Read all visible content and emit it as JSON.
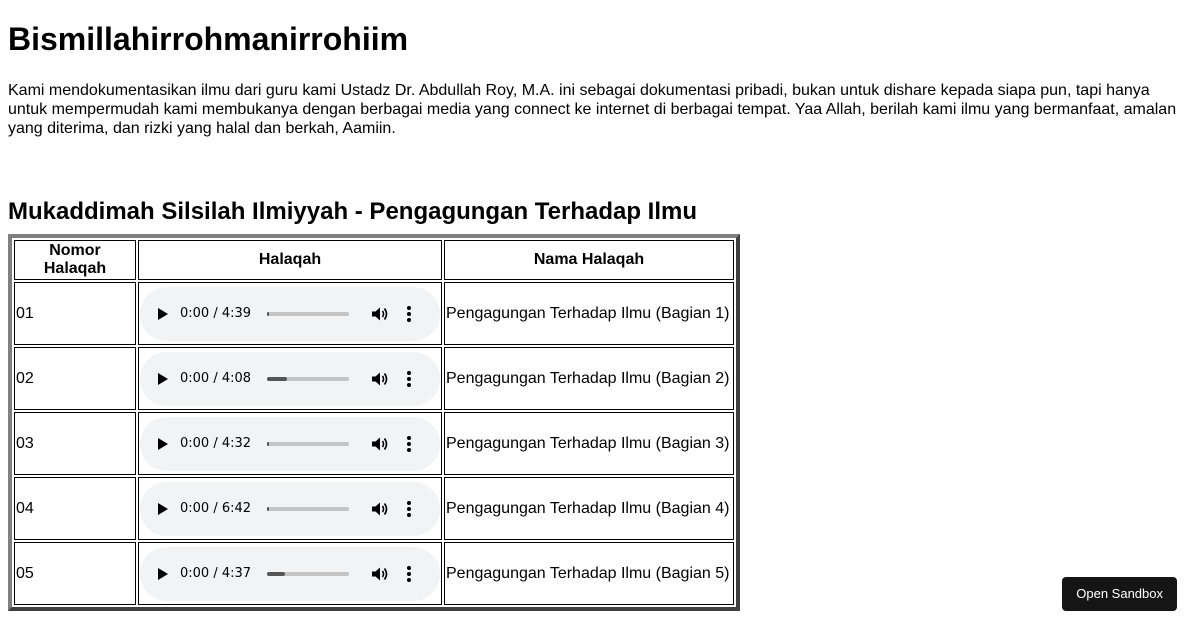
{
  "heading": "Bismillahirrohmanirrohiim",
  "intro": "Kami mendokumentasikan ilmu dari guru kami Ustadz Dr. Abdullah Roy, M.A. ini sebagai dokumentasi pribadi, bukan untuk dishare kepada siapa pun, tapi hanya untuk mempermudah kami membukanya dengan berbagai media yang connect ke internet di berbagai tempat. Yaa Allah, berilah kami ilmu yang bermanfaat, amalan yang diterima, dan rizki yang halal dan berkah, Aamiin.",
  "section_title": "Mukaddimah Silsilah Ilmiyyah - Pengagungan Terhadap Ilmu",
  "table": {
    "headers": [
      "Nomor Halaqah",
      "Halaqah",
      "Nama Halaqah"
    ],
    "rows": [
      {
        "nomor": "01",
        "time": "0:00 / 4:39",
        "buffered": 0.02,
        "nama": "Pengagungan Terhadap Ilmu (Bagian 1)"
      },
      {
        "nomor": "02",
        "time": "0:00 / 4:08",
        "buffered": 0.24,
        "nama": "Pengagungan Terhadap Ilmu (Bagian 2)"
      },
      {
        "nomor": "03",
        "time": "0:00 / 4:32",
        "buffered": 0.02,
        "nama": "Pengagungan Terhadap Ilmu (Bagian 3)"
      },
      {
        "nomor": "04",
        "time": "0:00 / 6:42",
        "buffered": 0.02,
        "nama": "Pengagungan Terhadap Ilmu (Bagian 4)"
      },
      {
        "nomor": "05",
        "time": "0:00 / 4:37",
        "buffered": 0.22,
        "nama": "Pengagungan Terhadap Ilmu (Bagian 5)"
      }
    ]
  },
  "icons": {
    "play": "play-icon",
    "volume": "volume-icon",
    "menu": "more-vert-icon"
  },
  "sandbox_button": "Open Sandbox",
  "colors": {
    "player_bg": "#f1f3f4",
    "sandbox_bg": "#151515"
  }
}
